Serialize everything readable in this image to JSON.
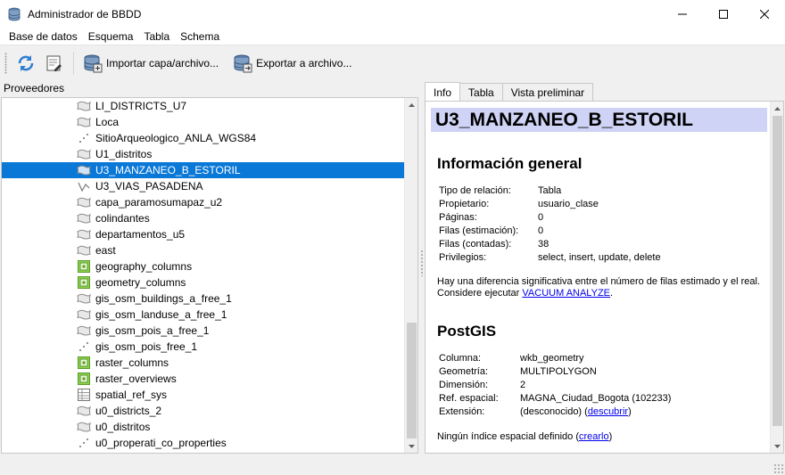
{
  "window": {
    "title": "Administrador de BBDD",
    "minimize_glyph": "—",
    "maximize_glyph": "☐",
    "close_glyph": "✕"
  },
  "menu": [
    {
      "label": "Base de datos"
    },
    {
      "label": "Esquema"
    },
    {
      "label": "Tabla"
    },
    {
      "label": "Schema"
    }
  ],
  "toolbar": {
    "refresh_icon": "refresh-icon",
    "sql_icon": "sql-window-icon",
    "import_label": "Importar capa/archivo...",
    "export_label": "Exportar a archivo..."
  },
  "providers": {
    "header": "Proveedores",
    "items": [
      {
        "label": "LI_DISTRICTS_U7",
        "icon": "polygon-layer-icon"
      },
      {
        "label": "Loca",
        "icon": "polygon-layer-icon"
      },
      {
        "label": "SitioArqueologico_ANLA_WGS84",
        "icon": "point-layer-icon"
      },
      {
        "label": "U1_distritos",
        "icon": "polygon-layer-icon"
      },
      {
        "label": "U3_MANZANEO_B_ESTORIL",
        "icon": "polygon-layer-icon",
        "selected": true
      },
      {
        "label": "U3_VIAS_PASADENA",
        "icon": "line-layer-icon"
      },
      {
        "label": "capa_paramosumapaz_u2",
        "icon": "polygon-layer-icon"
      },
      {
        "label": "colindantes",
        "icon": "polygon-layer-icon"
      },
      {
        "label": "departamentos_u5",
        "icon": "polygon-layer-icon"
      },
      {
        "label": "east",
        "icon": "polygon-layer-icon"
      },
      {
        "label": "geography_columns",
        "icon": "view-icon"
      },
      {
        "label": "geometry_columns",
        "icon": "view-icon"
      },
      {
        "label": "gis_osm_buildings_a_free_1",
        "icon": "polygon-layer-icon"
      },
      {
        "label": "gis_osm_landuse_a_free_1",
        "icon": "polygon-layer-icon"
      },
      {
        "label": "gis_osm_pois_a_free_1",
        "icon": "polygon-layer-icon"
      },
      {
        "label": "gis_osm_pois_free_1",
        "icon": "point-layer-icon"
      },
      {
        "label": "raster_columns",
        "icon": "view-icon"
      },
      {
        "label": "raster_overviews",
        "icon": "view-icon"
      },
      {
        "label": "spatial_ref_sys",
        "icon": "table-icon"
      },
      {
        "label": "u0_districts_2",
        "icon": "polygon-layer-icon"
      },
      {
        "label": "u0_distritos",
        "icon": "polygon-layer-icon"
      },
      {
        "label": "u0_properati_co_properties",
        "icon": "point-layer-icon"
      }
    ]
  },
  "tabs": [
    {
      "label": "Info",
      "active": true
    },
    {
      "label": "Tabla",
      "active": false
    },
    {
      "label": "Vista preliminar",
      "active": false
    }
  ],
  "info": {
    "title": "U3_MANZANEO_B_ESTORIL",
    "general_heading": "Información general",
    "general": [
      {
        "k": "Tipo de relación:",
        "v": "Tabla"
      },
      {
        "k": "Propietario:",
        "v": "usuario_clase"
      },
      {
        "k": "Páginas:",
        "v": "0"
      },
      {
        "k": "Filas (estimación):",
        "v": "0"
      },
      {
        "k": "Filas (contadas):",
        "v": "38"
      },
      {
        "k": "Privilegios:",
        "v": "select, insert, update, delete"
      }
    ],
    "warning_line1": "Hay una diferencia significativa entre el número de filas estimado y el real.",
    "warning_line2_prefix": "Considere ejecutar ",
    "warning_link": "VACUUM ANALYZE",
    "warning_line2_suffix": ".",
    "postgis_heading": "PostGIS",
    "postgis": [
      {
        "k": "Columna:",
        "v": "wkb_geometry"
      },
      {
        "k": "Geometría:",
        "v": "MULTIPOLYGON"
      },
      {
        "k": "Dimensión:",
        "v": "2"
      },
      {
        "k": "Ref. espacial:",
        "v": "MAGNA_Ciudad_Bogota (102233)"
      }
    ],
    "extent_label": "Extensión:",
    "extent_value": "(desconocido) (",
    "extent_link": "descubrir",
    "extent_close": ")",
    "index_text": "Ningún índice espacial definido (",
    "index_link": "crearlo",
    "index_close": ")"
  },
  "colors": {
    "selection": "#0a78d7",
    "title_highlight": "#cfd3f5",
    "link": "#0000ee"
  }
}
